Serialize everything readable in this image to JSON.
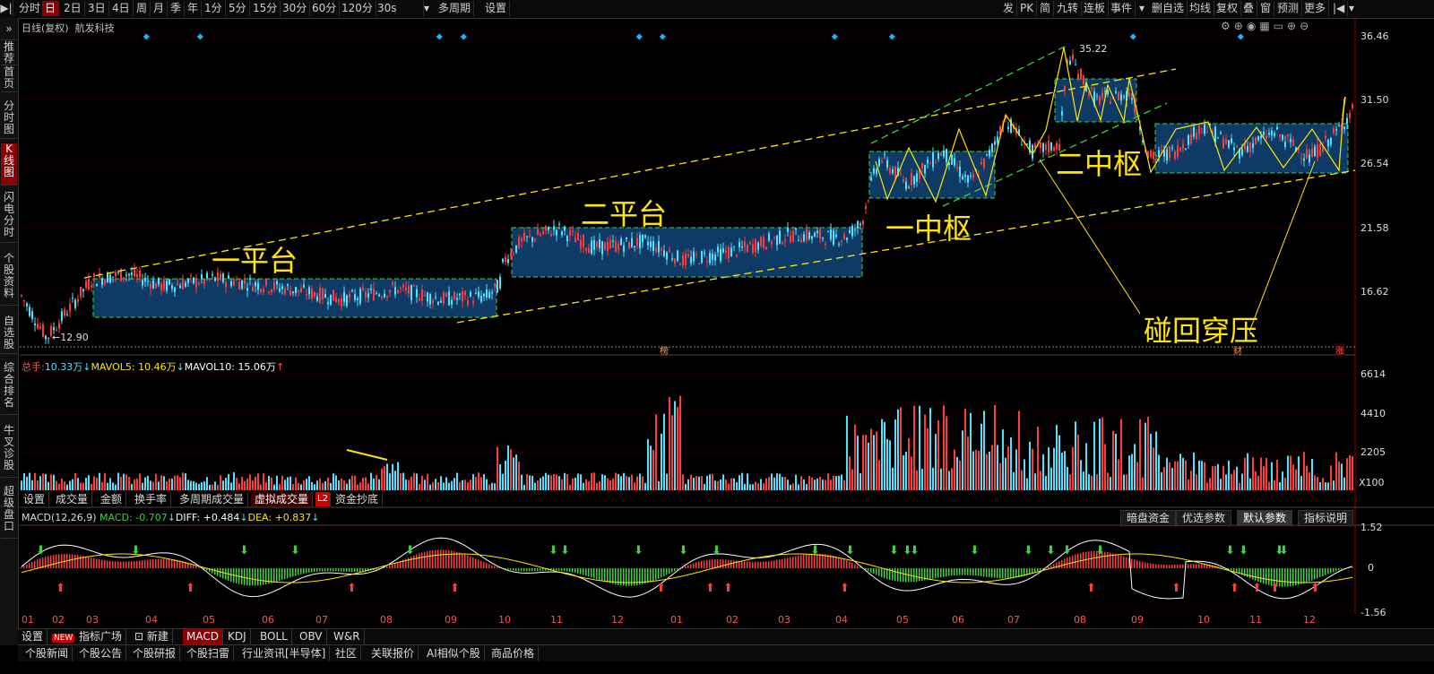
{
  "toolbar": {
    "left": [
      "分时",
      "日",
      "2日",
      "3日",
      "4日",
      "周",
      "月",
      "季",
      "年",
      "1分",
      "5分",
      "15分",
      "30分",
      "60分",
      "120分",
      "30s",
      "多周期",
      "设置"
    ],
    "active": "日",
    "right": [
      "发",
      "PK",
      "简",
      "九转",
      "连板",
      "事件",
      "删自选",
      "均线",
      "复权",
      "叠",
      "窗",
      "预测",
      "更多"
    ]
  },
  "sidebar": [
    "推荐",
    "首页",
    "分时图",
    "K线图",
    "闪电分时",
    "个股资料",
    "自选股",
    "综合排名",
    "牛叉诊股",
    "超级盘口"
  ],
  "sidebar_active": "K线图",
  "chart_header": {
    "mode": "日线(复权)",
    "stock": "航发科技"
  },
  "price_axis": [
    "36.46",
    "31.50",
    "26.54",
    "21.58",
    "16.62"
  ],
  "price_labels": {
    "high": "35.22",
    "low": "12.90"
  },
  "annotations": {
    "p1": "一平台",
    "p2": "二平台",
    "z1": "一中枢",
    "z2": "二中枢",
    "pierce": "碰回穿压"
  },
  "markers": {
    "bang": "榜",
    "cai": "财",
    "zhang": "涨"
  },
  "volume_header": {
    "total_label": "总手:",
    "total_value": "10.33万",
    "ma5_label": "MAVOL5:",
    "ma5_value": "10.46万",
    "ma10_label": "MAVOL10:",
    "ma10_value": "15.06万"
  },
  "volume_axis": [
    "6614",
    "4410",
    "2205",
    "X100"
  ],
  "volume_tabs": [
    "设置",
    "成交量",
    "金额",
    "换手率",
    "多周期成交量",
    "虚拟成交量",
    "资金抄底"
  ],
  "volume_tabs_active": "虚拟成交量",
  "l2_badge": "L2",
  "macd_header": {
    "name": "MACD(12,26,9)",
    "macd_label": "MACD:",
    "macd_value": "-0.707",
    "diff_label": "DIFF:",
    "diff_value": "+0.484",
    "dea_label": "DEA:",
    "dea_value": "+0.837"
  },
  "macd_axis": [
    "1.52",
    "0",
    "-1.56"
  ],
  "macd_tabs": [
    "暗盘资金",
    "优选参数",
    "默认参数",
    "指标说明"
  ],
  "macd_tabs_active": "默认参数",
  "months": [
    "01",
    "02",
    "03",
    "04",
    "05",
    "06",
    "07",
    "08",
    "09",
    "10",
    "11",
    "12",
    "01",
    "02",
    "03",
    "04",
    "05",
    "06",
    "07",
    "08",
    "09",
    "10",
    "11",
    "12"
  ],
  "indicator_tabs": {
    "settings": "设置",
    "new_badge": "NEW",
    "plaza": "指标广场",
    "new": "新建",
    "items": [
      "MACD",
      "KDJ",
      "BOLL",
      "OBV",
      "W&R"
    ],
    "active": "MACD"
  },
  "bottom_tabs": [
    "个股新闻",
    "个股公告",
    "个股研报",
    "个股扫雷",
    "行业资讯[半导体]",
    "社区",
    "关联报价",
    "AI相似个股",
    "商品价格"
  ],
  "colors": {
    "up": "#ff3b3b",
    "down": "#4fe3ff",
    "box": "#0e3a66",
    "yellow": "#ffe600",
    "green": "#3fd13f"
  }
}
